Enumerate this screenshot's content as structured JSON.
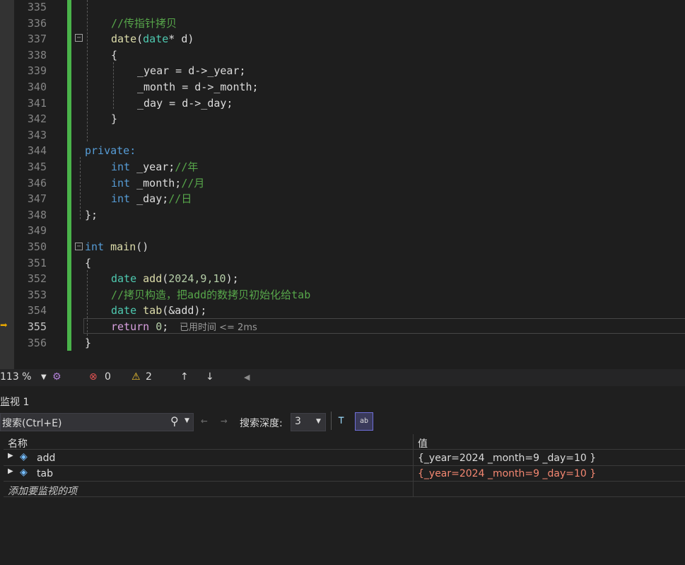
{
  "editor": {
    "lines": [
      {
        "n": "335"
      },
      {
        "n": "336"
      },
      {
        "n": "337"
      },
      {
        "n": "338"
      },
      {
        "n": "339"
      },
      {
        "n": "340"
      },
      {
        "n": "341"
      },
      {
        "n": "342"
      },
      {
        "n": "343"
      },
      {
        "n": "344"
      },
      {
        "n": "345"
      },
      {
        "n": "346"
      },
      {
        "n": "347"
      },
      {
        "n": "348"
      },
      {
        "n": "349"
      },
      {
        "n": "350"
      },
      {
        "n": "351"
      },
      {
        "n": "352"
      },
      {
        "n": "353"
      },
      {
        "n": "354"
      },
      {
        "n": "355"
      },
      {
        "n": "356"
      }
    ],
    "code": {
      "c336": "//传指针拷贝",
      "c337_fn": "date",
      "c337_p1": "(",
      "c337_ty": "date",
      "c337_p2": "* d)",
      "c338": "{",
      "c339": "_year = d->_year;",
      "c340": "_month = d->_month;",
      "c341": "_day = d->_day;",
      "c342": "}",
      "c344": "private:",
      "c345_kw": "int",
      "c345_v": " _year;",
      "c345_cm": "//年",
      "c346_kw": "int",
      "c346_v": " _month;",
      "c346_cm": "//月",
      "c347_kw": "int",
      "c347_v": " _day;",
      "c347_cm": "//日",
      "c348": "};",
      "c350_kw": "int",
      "c350_fn": " main",
      "c350_p": "()",
      "c351": "{",
      "c352_ty": "date",
      "c352_fn": " add",
      "c352_p1": "(",
      "c352_n": "2024,9,10",
      "c352_p2": ");",
      "c353": "//拷贝构造，把add的数拷贝初始化给tab",
      "c354_ty": "date",
      "c354_fn": " tab",
      "c354_p": "(&add);",
      "c355_kw": "return",
      "c355_n": " 0",
      "c355_p": ";",
      "c356": "}"
    },
    "elapsed": "已用时间 <= 2ms"
  },
  "statusbar": {
    "zoom": "113 %",
    "errors": "0",
    "warnings": "2"
  },
  "watch": {
    "title": "监视 1",
    "search_placeholder": "搜索(Ctrl+E)",
    "depth_label": "搜索深度:",
    "depth_value": "3",
    "col_name": "名称",
    "col_value": "值",
    "rows": [
      {
        "name": "add",
        "value": "{_year=2024 _month=9 _day=10 }"
      },
      {
        "name": "tab",
        "value": "{_year=2024 _month=9 _day=10 }"
      }
    ],
    "add_item": "添加要监视的项",
    "colors": {
      "changed_value": "#f48771"
    }
  }
}
